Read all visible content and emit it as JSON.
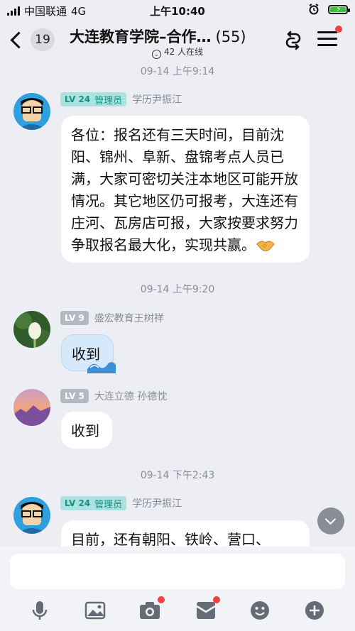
{
  "status_bar": {
    "carrier": "中国联通",
    "network": "4G",
    "time": "上午10:40"
  },
  "header": {
    "unread_count": "19",
    "title": "大连教育学院–合作…",
    "member_count": "(55)",
    "online": "42 人在线"
  },
  "messages": [
    {
      "timestamp": "09-14 上午9:14",
      "level": "LV 24",
      "role": "管理员",
      "sender": "学历尹振江",
      "text": "各位：报名还有三天时间，目前沈阳、锦州、阜新、盘锦考点人员已满，大家可密切关注本地区可能开放情况。其它地区仍可报考，大连还有庄河、瓦房店可报，大家按要求努力争取报名最大化，实现共赢。",
      "emoji": "handshake-emoji"
    },
    {
      "timestamp": "09-14 上午9:20",
      "level": "LV 9",
      "sender": "盛宏教育王树祥",
      "text": "收到"
    },
    {
      "level": "LV 5",
      "sender": "大连立德 孙德忱",
      "text": "收到"
    },
    {
      "timestamp": "09-14 下午2:43",
      "level": "LV 24",
      "role": "管理员",
      "sender": "学历尹振江",
      "text": "目前，还有朝阳、铁岭、营口、"
    }
  ],
  "input": {
    "placeholder": ""
  },
  "toolbar": [
    "mic-icon",
    "image-icon",
    "camera-icon",
    "red-packet-icon",
    "emoji-icon",
    "plus-icon"
  ],
  "colors": {
    "accent_red": "#f04040",
    "admin_badge": "#a9e2df",
    "battery": "#3ec141"
  }
}
